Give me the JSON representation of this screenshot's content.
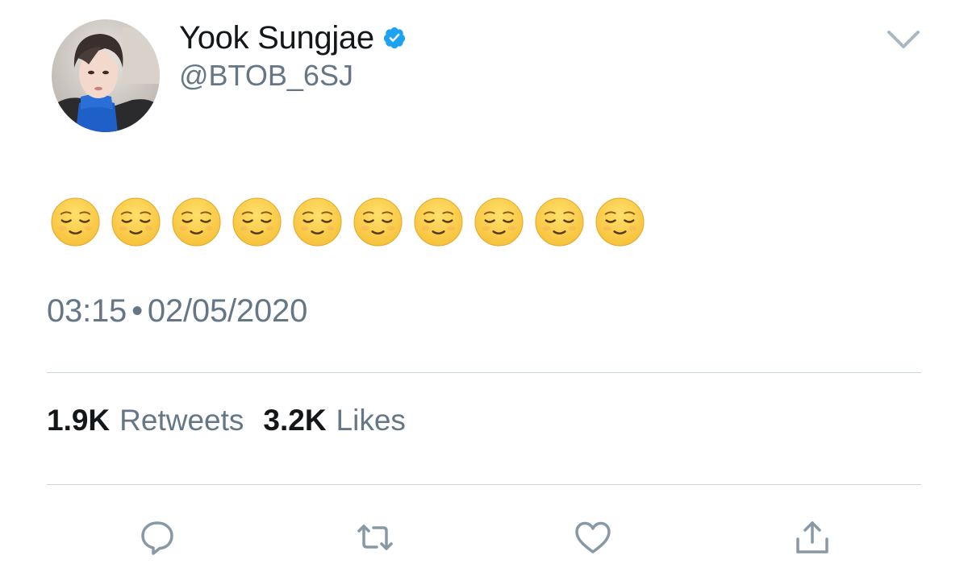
{
  "author": {
    "display_name": "Yook Sungjae",
    "handle": "@BTOB_6SJ",
    "verified": true,
    "avatar": "profile-photo"
  },
  "tweet": {
    "emoji_name": "relieved-face",
    "emojis": [
      "😌",
      "😌",
      "😌",
      "😌",
      "😌",
      "😌",
      "😌",
      "😌",
      "😌",
      "😌"
    ],
    "time": "03:15",
    "separator": "•",
    "date": "02/05/2020"
  },
  "stats": {
    "retweets_count": "1.9K",
    "retweets_label": "Retweets",
    "likes_count": "3.2K",
    "likes_label": "Likes"
  },
  "actions": {
    "reply_icon": "reply-icon",
    "retweet_icon": "retweet-icon",
    "like_icon": "heart-icon",
    "share_icon": "share-icon"
  },
  "colors": {
    "text_primary": "#14171a",
    "text_secondary": "#657786",
    "verified_blue": "#1da1f2",
    "divider": "#ccd6dd",
    "icon_gray": "#8899a6",
    "emoji_yellow": "#f7c23b"
  }
}
